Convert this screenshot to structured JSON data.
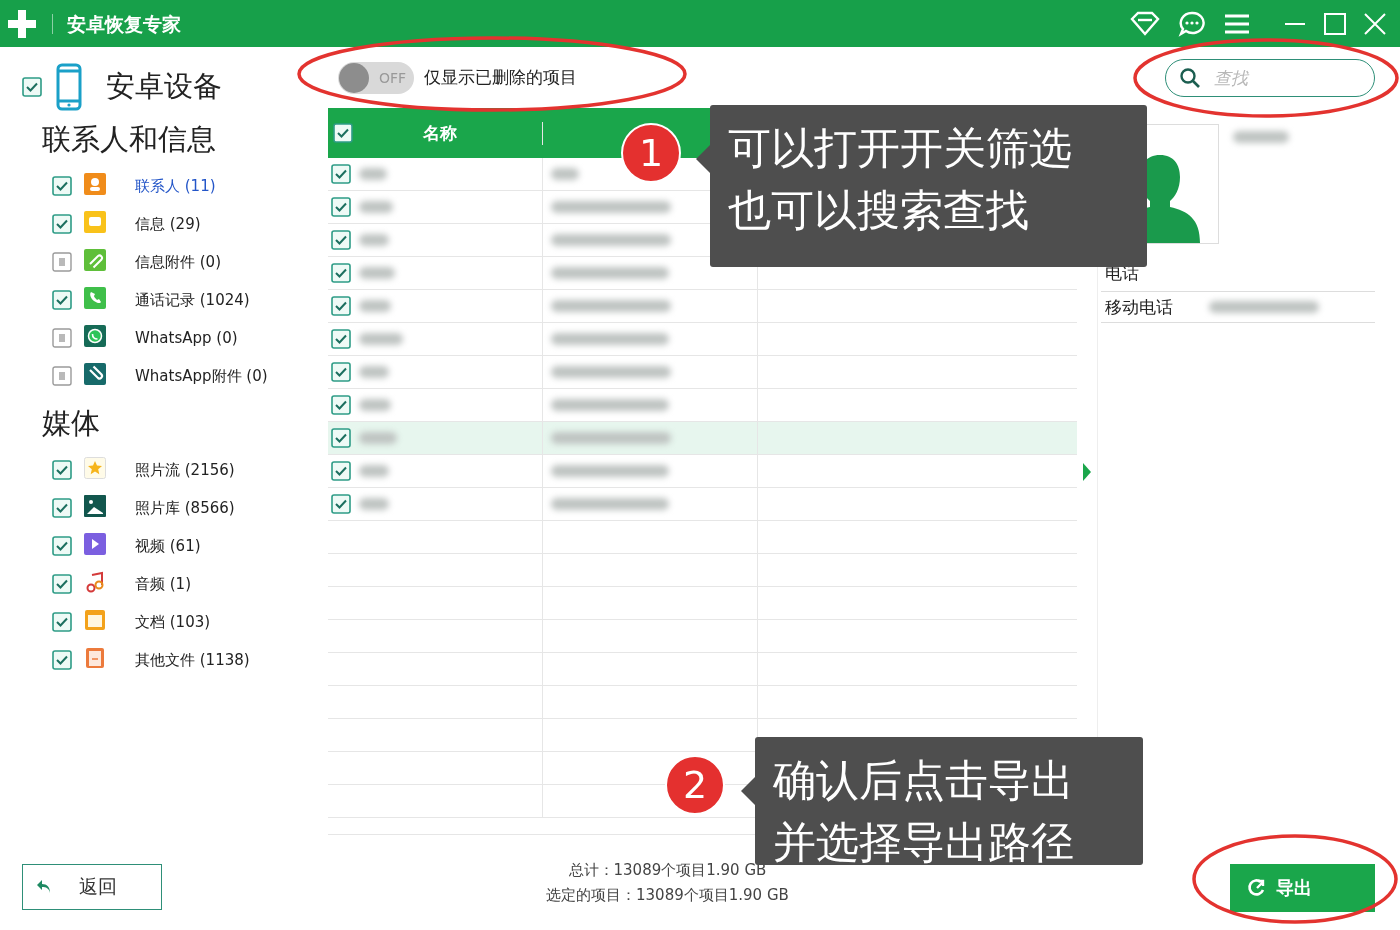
{
  "window": {
    "title": "安卓恢复专家"
  },
  "sidebar": {
    "device": {
      "label": "安卓设备",
      "checked": true
    },
    "groups": [
      {
        "title": "联系人和信息",
        "items": [
          {
            "kind": "contacts",
            "label": "联系人 (11)",
            "checked": true,
            "selected": true
          },
          {
            "kind": "messages",
            "label": "信息 (29)",
            "checked": true,
            "selected": false
          },
          {
            "kind": "attachments",
            "label": "信息附件 (0)",
            "checked": false,
            "selected": false
          },
          {
            "kind": "calls",
            "label": "通话记录 (1024)",
            "checked": true,
            "selected": false
          },
          {
            "kind": "whatsapp",
            "label": "WhatsApp (0)",
            "checked": false,
            "selected": false
          },
          {
            "kind": "whatsapp_attachments",
            "label": "WhatsApp附件 (0)",
            "checked": false,
            "selected": false
          }
        ]
      },
      {
        "title": "媒体",
        "items": [
          {
            "kind": "photostream",
            "label": "照片流 (2156)",
            "checked": true,
            "selected": false
          },
          {
            "kind": "gallery",
            "label": "照片库 (8566)",
            "checked": true,
            "selected": false
          },
          {
            "kind": "video",
            "label": "视频 (61)",
            "checked": true,
            "selected": false
          },
          {
            "kind": "audio",
            "label": "音频 (1)",
            "checked": true,
            "selected": false
          },
          {
            "kind": "documents",
            "label": "文档 (103)",
            "checked": true,
            "selected": false
          },
          {
            "kind": "other",
            "label": "其他文件 (1138)",
            "checked": true,
            "selected": false
          }
        ]
      }
    ],
    "back_button": "返回"
  },
  "filter": {
    "switch_text": "OFF",
    "on": false,
    "label": "仅显示已删除的项目"
  },
  "search": {
    "placeholder": "查找"
  },
  "table": {
    "header_checked": true,
    "columns": [
      "名称"
    ],
    "rows": [
      {
        "checked": true,
        "selected": false
      },
      {
        "checked": true,
        "selected": false
      },
      {
        "checked": true,
        "selected": false
      },
      {
        "checked": true,
        "selected": false
      },
      {
        "checked": true,
        "selected": false
      },
      {
        "checked": true,
        "selected": false
      },
      {
        "checked": true,
        "selected": false
      },
      {
        "checked": true,
        "selected": false
      },
      {
        "checked": true,
        "selected": true
      },
      {
        "checked": true,
        "selected": false
      },
      {
        "checked": true,
        "selected": false
      }
    ]
  },
  "detail": {
    "section": "电话",
    "fields": [
      {
        "label": "移动电话"
      }
    ]
  },
  "status": {
    "total": "总计：13089个项目1.90 GB",
    "selected": "选定的项目：13089个项目1.90 GB"
  },
  "export_button": "导出",
  "callouts": [
    {
      "number": "1",
      "lines": [
        "可以打开开关筛选",
        "也可以搜索查找"
      ]
    },
    {
      "number": "2",
      "lines": [
        "确认后点击导出",
        "并选择导出路径"
      ]
    }
  ]
}
